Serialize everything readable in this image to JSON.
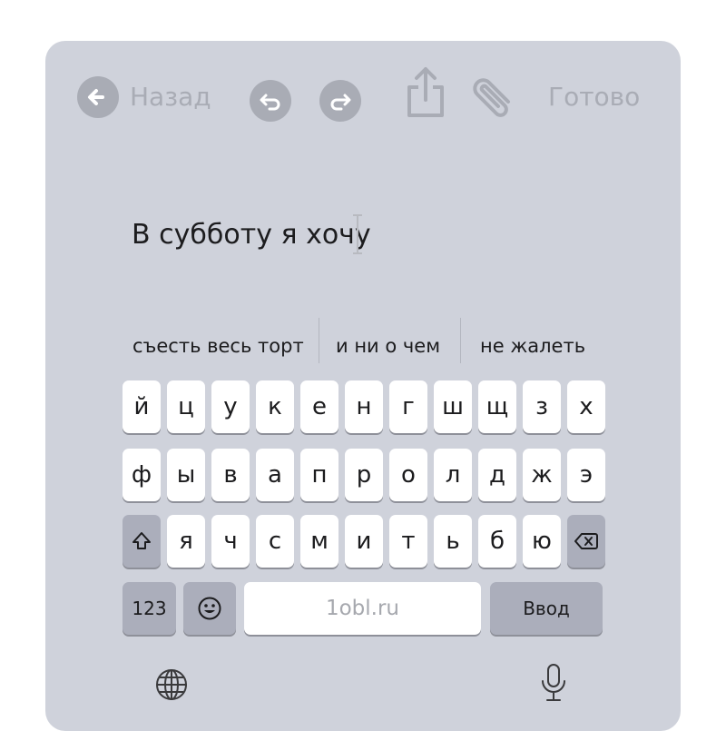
{
  "toolbar": {
    "back_label": "Назад",
    "done_label": "Готово",
    "icons": [
      "back-arrow-icon",
      "undo-icon",
      "redo-icon",
      "share-icon",
      "paperclip-icon"
    ]
  },
  "editor": {
    "text": "В субботу я хочу"
  },
  "suggestions": [
    "съесть весь торт",
    "и ни о чем",
    "не жалеть"
  ],
  "keyboard": {
    "row1": [
      "й",
      "ц",
      "у",
      "к",
      "е",
      "н",
      "г",
      "ш",
      "щ",
      "з",
      "х"
    ],
    "row2": [
      "ф",
      "ы",
      "в",
      "а",
      "п",
      "р",
      "о",
      "л",
      "д",
      "ж",
      "э"
    ],
    "row3": [
      "я",
      "ч",
      "с",
      "м",
      "и",
      "т",
      "ь",
      "б",
      "ю"
    ],
    "numbers_label": "123",
    "space_label": "1obl.ru",
    "enter_label": "Ввод",
    "icons": [
      "shift-icon",
      "backspace-icon",
      "emoji-icon",
      "globe-icon",
      "microphone-icon"
    ]
  },
  "colors": {
    "background": "#cfd2db",
    "key": "#ffffff",
    "function_key": "#abaebb",
    "toolbar_muted": "#a9acb5",
    "text": "#1c1c1e"
  }
}
